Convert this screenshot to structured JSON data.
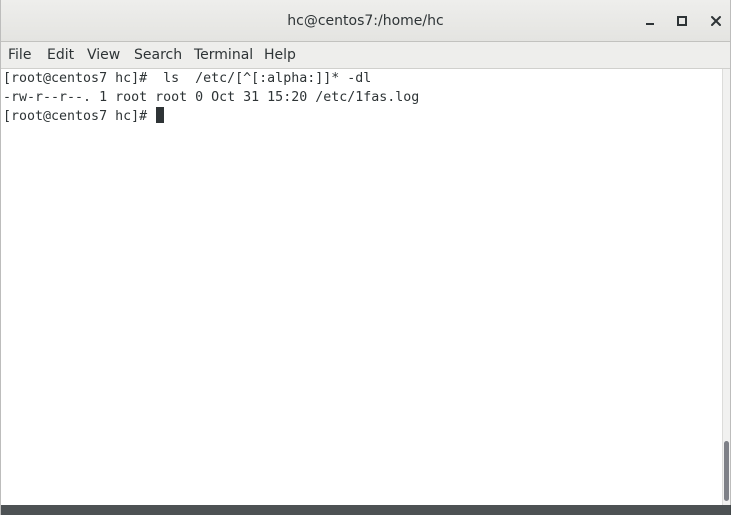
{
  "window": {
    "title": "hc@centos7:/home/hc"
  },
  "menu": {
    "file": "File",
    "edit": "Edit",
    "view": "View",
    "search": "Search",
    "terminal": "Terminal",
    "help": "Help"
  },
  "terminal": {
    "lines": [
      "[root@centos7 hc]#  ls  /etc/[^[:alpha:]]* -dl",
      "-rw-r--r--. 1 root root 0 Oct 31 15:20 /etc/1fas.log",
      "[root@centos7 hc]# "
    ]
  },
  "icons": {
    "minimize": "minimize-icon",
    "maximize": "maximize-icon",
    "close": "close-icon"
  },
  "colors": {
    "titlebar": "#e8e8e6",
    "terminal_bg": "#ffffff",
    "text": "#2e3436",
    "scroll_thumb": "#7e8087"
  }
}
